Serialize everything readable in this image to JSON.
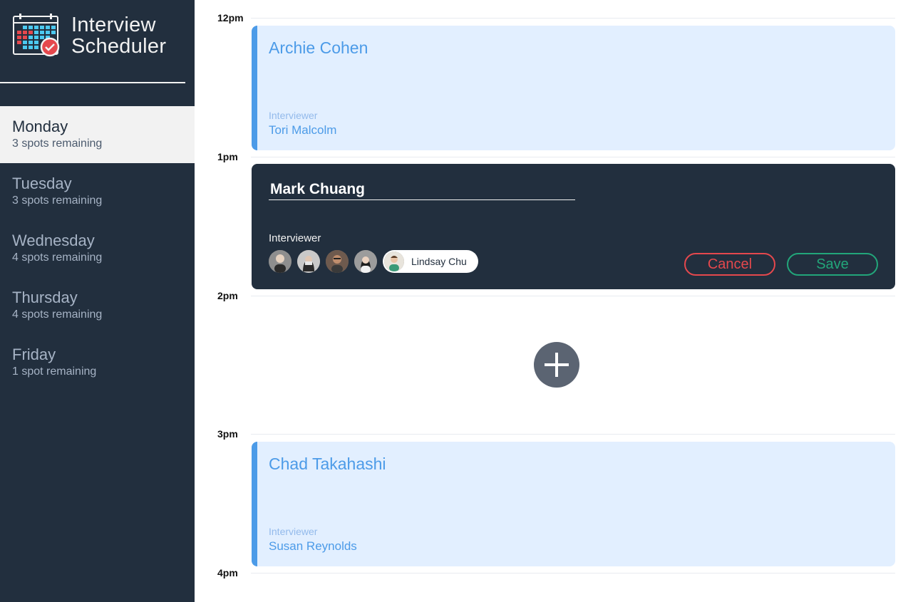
{
  "app": {
    "title_line1": "Interview",
    "title_line2": "Scheduler",
    "logo_icon": "calendar-check-icon"
  },
  "days": [
    {
      "name": "Monday",
      "spots": "3 spots remaining",
      "selected": true
    },
    {
      "name": "Tuesday",
      "spots": "3 spots remaining",
      "selected": false
    },
    {
      "name": "Wednesday",
      "spots": "4 spots remaining",
      "selected": false
    },
    {
      "name": "Thursday",
      "spots": "4 spots remaining",
      "selected": false
    },
    {
      "name": "Friday",
      "spots": "1 spot remaining",
      "selected": false
    }
  ],
  "times": [
    "12pm",
    "1pm",
    "2pm",
    "3pm",
    "4pm"
  ],
  "appointments": {
    "noon": {
      "student": "Archie Cohen",
      "interviewer_label": "Interviewer",
      "interviewer": "Tori Malcolm"
    },
    "one": {
      "student_value": "Mark Chuang",
      "interviewer_label": "Interviewer",
      "selected_interviewer": "Lindsay Chu",
      "cancel_label": "Cancel",
      "save_label": "Save"
    },
    "three": {
      "student": "Chad Takahashi",
      "interviewer_label": "Interviewer",
      "interviewer": "Susan Reynolds"
    }
  },
  "add_icon": "plus-icon",
  "colors": {
    "sidebar": "#222f3e",
    "accent_blue": "#4c9be8",
    "appointment_bg": "#e2efff",
    "danger": "#e5484d",
    "success": "#22a67a",
    "add_button": "#5b6472"
  }
}
